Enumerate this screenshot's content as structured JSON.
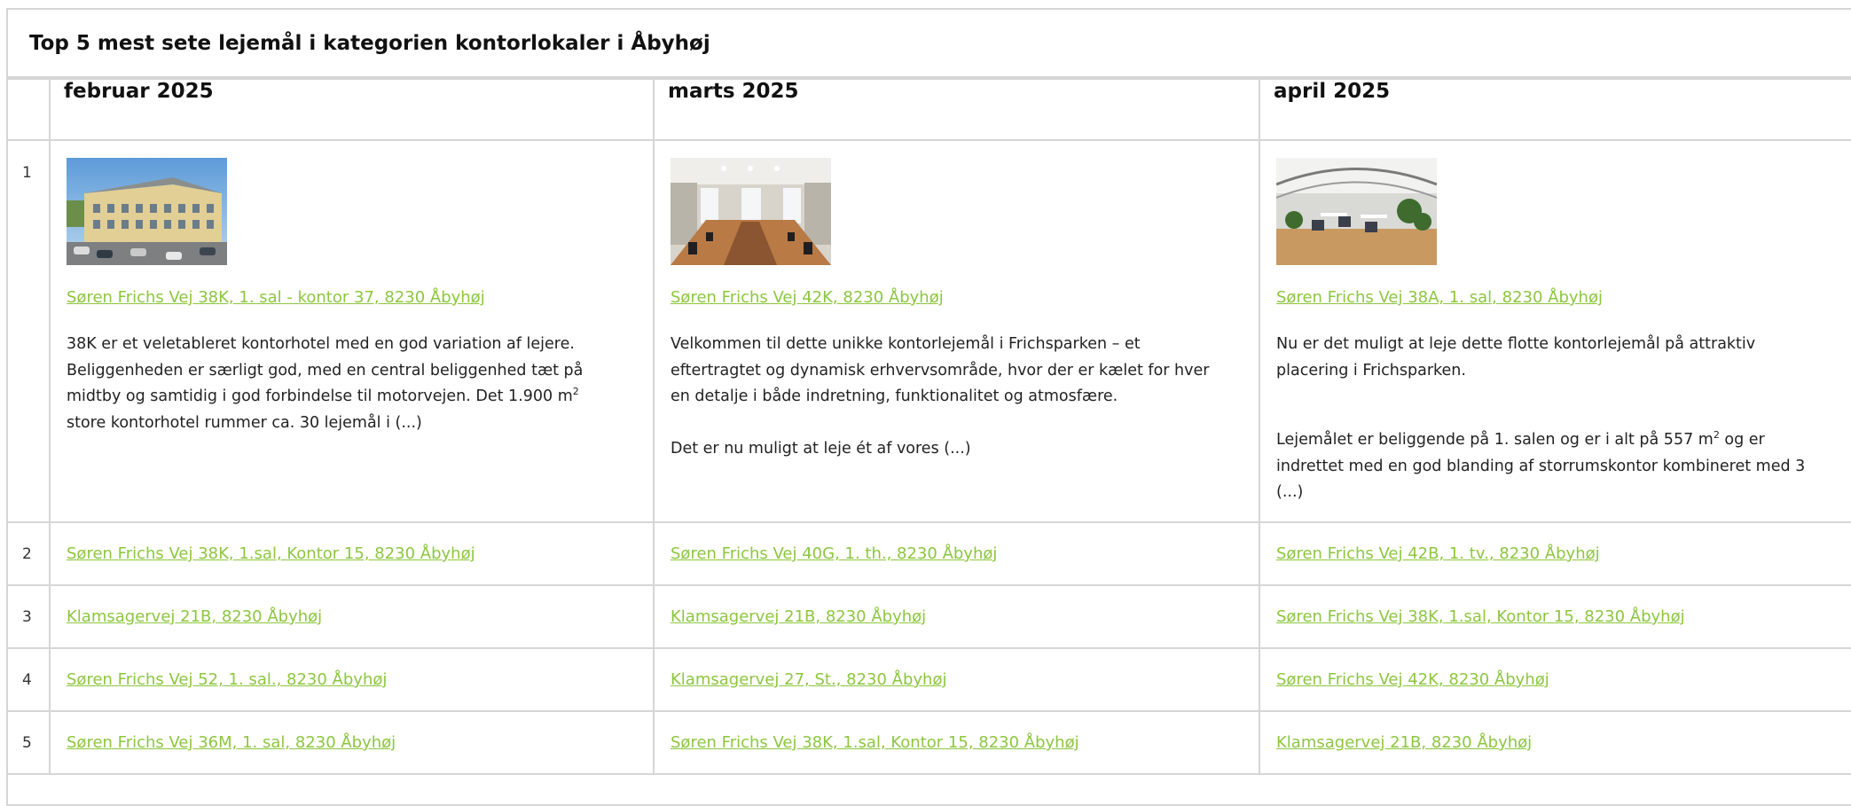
{
  "panel": {
    "title": "Top 5 mest sete lejemål i kategorien kontorlokaler i Åbyhøj"
  },
  "columns": [
    "februar 2025",
    "marts 2025",
    "april 2025"
  ],
  "ranks": [
    "1",
    "2",
    "3",
    "4",
    "5"
  ],
  "featured": [
    {
      "link": "Søren Frichs Vej 38K, 1. sal - kontor 37, 8230 Åbyhøj",
      "image": "building-exterior-photo",
      "paragraphs": [
        {
          "before": "38K er et veletableret kontorhotel med en god variation af lejere. Beliggenheden er særligt god, med en central beliggenhed tæt på midtby og samtidig i god forbindelse til motorvejen. Det 1.900 m",
          "sup": "2",
          "after": " store kontorhotel rummer ca. 30 lejemål i (...)"
        }
      ]
    },
    {
      "link": "Søren Frichs Vej 42K, 8230 Åbyhøj",
      "image": "office-interior-photo",
      "paragraphs": [
        {
          "before": "Velkommen til dette unikke kontorlejemål i Frichsparken – et eftertragtet og dynamisk erhvervsområde, hvor der er kælet for hver en detalje i både indretning, funktionalitet og atmosfære.",
          "sup": "",
          "after": ""
        },
        {
          "before": "Det er nu muligt at leje ét af vores (...)",
          "sup": "",
          "after": ""
        }
      ]
    },
    {
      "link": "Søren Frichs Vej 38A, 1. sal, 8230 Åbyhøj",
      "image": "open-office-photo",
      "paragraphs": [
        {
          "before": "Nu er det muligt at leje dette flotte kontorlejemål på attraktiv placering i Frichsparken.",
          "sup": "",
          "after": ""
        },
        {
          "before": "Lejemålet er beliggende på 1. salen og er i alt på 557 m",
          "sup": "2",
          "after": " og er indrettet med en god blanding af storrumskontor kombineret med 3 (...)"
        }
      ]
    }
  ],
  "rows": [
    [
      "Søren Frichs Vej 38K, 1.sal, Kontor 15, 8230 Åbyhøj",
      "Søren Frichs Vej 40G, 1. th., 8230 Åbyhøj",
      "Søren Frichs Vej 42B, 1. tv., 8230 Åbyhøj"
    ],
    [
      "Klamsagervej 21B, 8230 Åbyhøj",
      "Klamsagervej 21B, 8230 Åbyhøj",
      "Søren Frichs Vej 38K, 1.sal, Kontor 15, 8230 Åbyhøj"
    ],
    [
      "Søren Frichs Vej 52, 1. sal., 8230 Åbyhøj",
      "Klamsagervej 27, St., 8230 Åbyhøj",
      "Søren Frichs Vej 42K, 8230 Åbyhøj"
    ],
    [
      "Søren Frichs Vej 36M, 1. sal, 8230 Åbyhøj",
      "Søren Frichs Vej 38K, 1.sal, Kontor 15, 8230 Åbyhøj",
      "Klamsagervej 21B, 8230 Åbyhøj"
    ]
  ],
  "colors": {
    "link": "#8cc63f",
    "border": "#d6d6d6",
    "text": "#222222"
  }
}
